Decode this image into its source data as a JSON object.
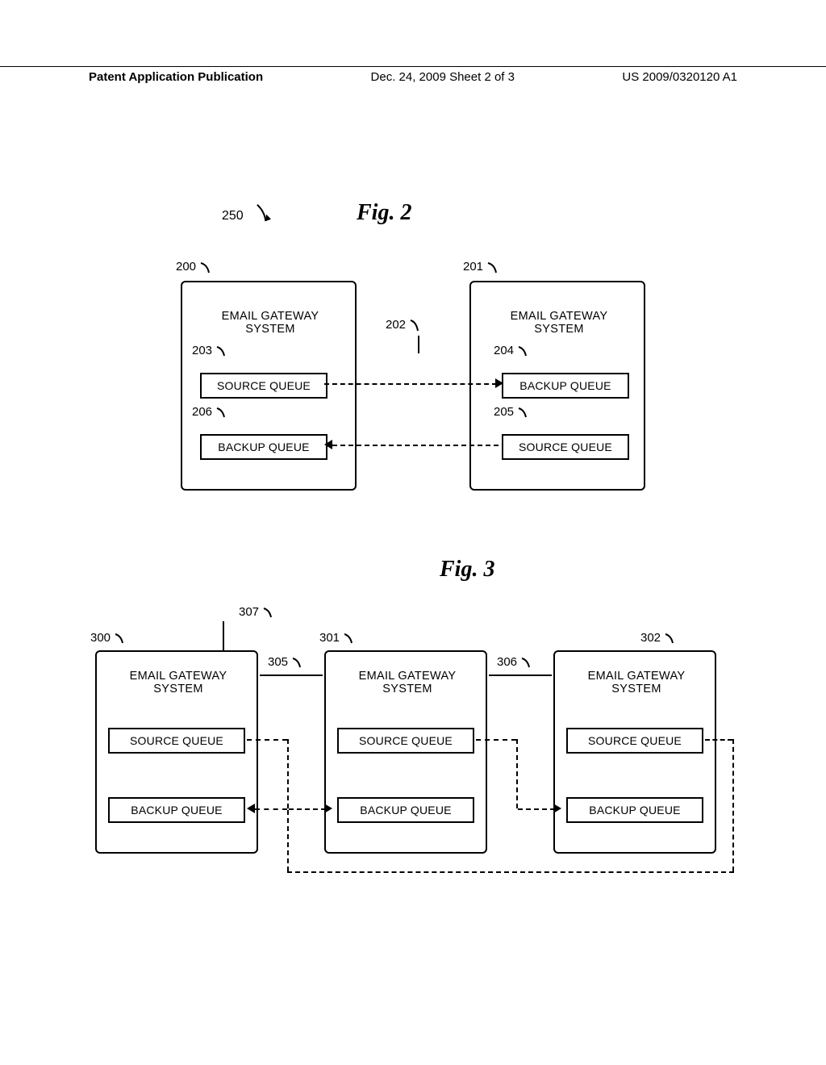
{
  "header": {
    "left": "Patent Application Publication",
    "mid": "Dec. 24, 2009  Sheet 2 of 3",
    "right": "US 2009/0320120 A1"
  },
  "fig2": {
    "title": "Fig. 2",
    "ref250": "250",
    "box200": {
      "ref": "200",
      "title_line1": "EMAIL GATEWAY",
      "title_line2": "SYSTEM",
      "source_ref": "203",
      "source_label": "SOURCE QUEUE",
      "backup_ref": "206",
      "backup_label": "BACKUP QUEUE"
    },
    "box201": {
      "ref": "201",
      "title_line1": "EMAIL GATEWAY",
      "title_line2": "SYSTEM",
      "backup_ref": "204",
      "backup_label": "BACKUP QUEUE",
      "source_ref": "205",
      "source_label": "SOURCE QUEUE"
    },
    "mid_ref": "202"
  },
  "fig3": {
    "title": "Fig. 3",
    "ref307": "307",
    "box300": {
      "ref": "300",
      "title_line1": "EMAIL GATEWAY",
      "title_line2": "SYSTEM",
      "source_label": "SOURCE QUEUE",
      "backup_label": "BACKUP QUEUE"
    },
    "box301": {
      "ref": "301",
      "title_line1": "EMAIL GATEWAY",
      "title_line2": "SYSTEM",
      "source_label": "SOURCE QUEUE",
      "backup_label": "BACKUP QUEUE"
    },
    "box302": {
      "ref": "302",
      "title_line1": "EMAIL GATEWAY",
      "title_line2": "SYSTEM",
      "source_label": "SOURCE QUEUE",
      "backup_label": "BACKUP QUEUE"
    },
    "ref305": "305",
    "ref306": "306"
  }
}
